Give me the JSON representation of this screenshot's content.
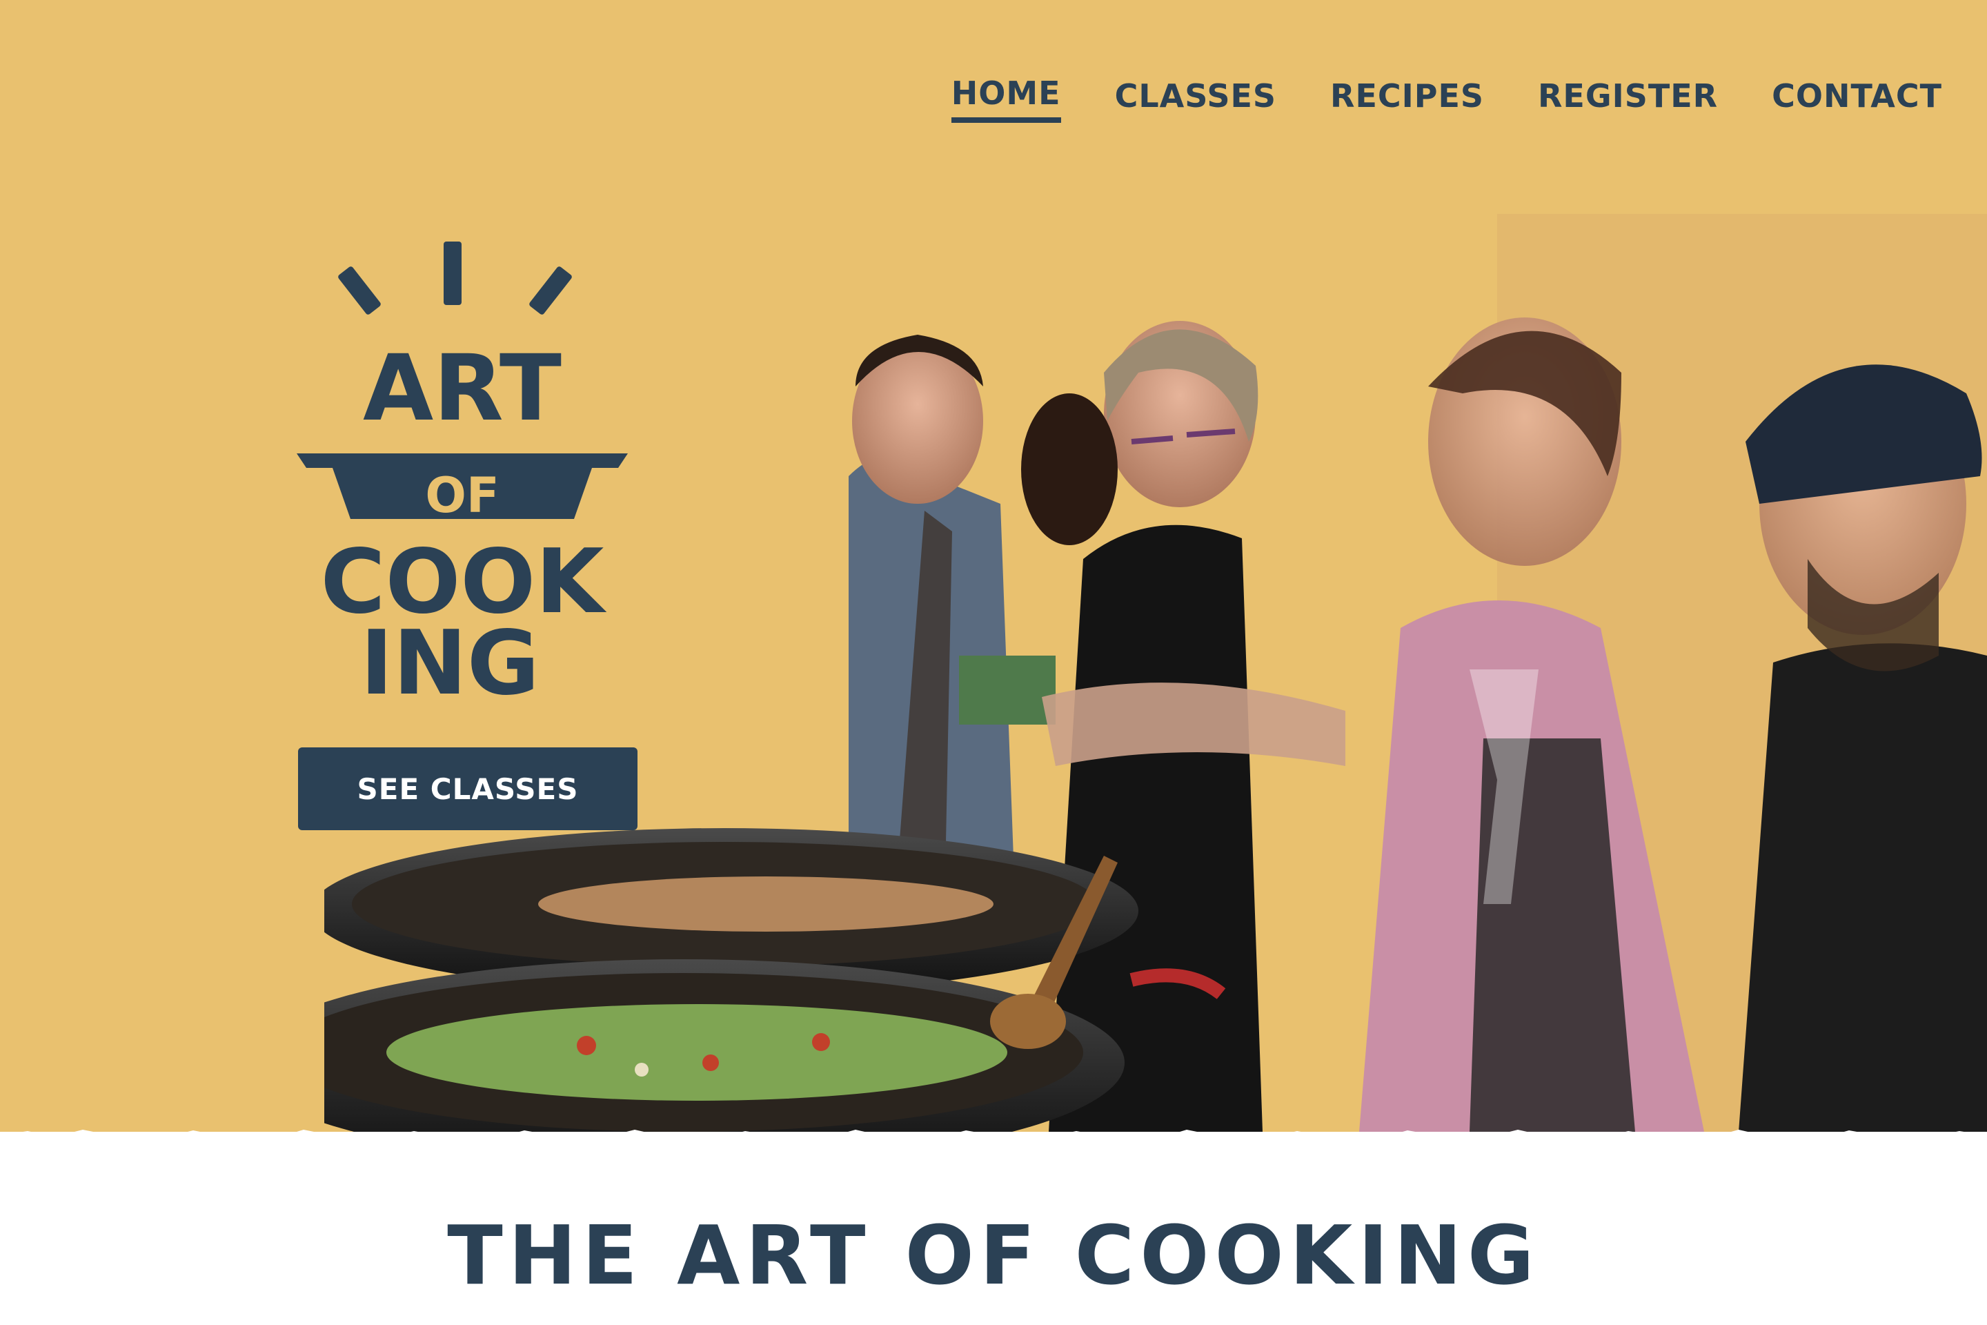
{
  "nav": {
    "items": [
      {
        "label": "HOME",
        "active": true
      },
      {
        "label": "CLASSES",
        "active": false
      },
      {
        "label": "RECIPES",
        "active": false
      },
      {
        "label": "REGISTER",
        "active": false
      },
      {
        "label": "CONTACT",
        "active": false
      }
    ]
  },
  "logo": {
    "line1": "ART",
    "line2": "OF",
    "line3": "COOK",
    "line4": "ING"
  },
  "hero": {
    "cta_label": "SEE CLASSES"
  },
  "main": {
    "headline": "THE ART OF COOKING"
  },
  "colors": {
    "hero_background": "#e9c16f",
    "brand_navy": "#2b4155",
    "page_background": "#ffffff"
  },
  "icons": {
    "logo_rays": "steam-rays-icon",
    "logo_pan": "pan-icon"
  }
}
